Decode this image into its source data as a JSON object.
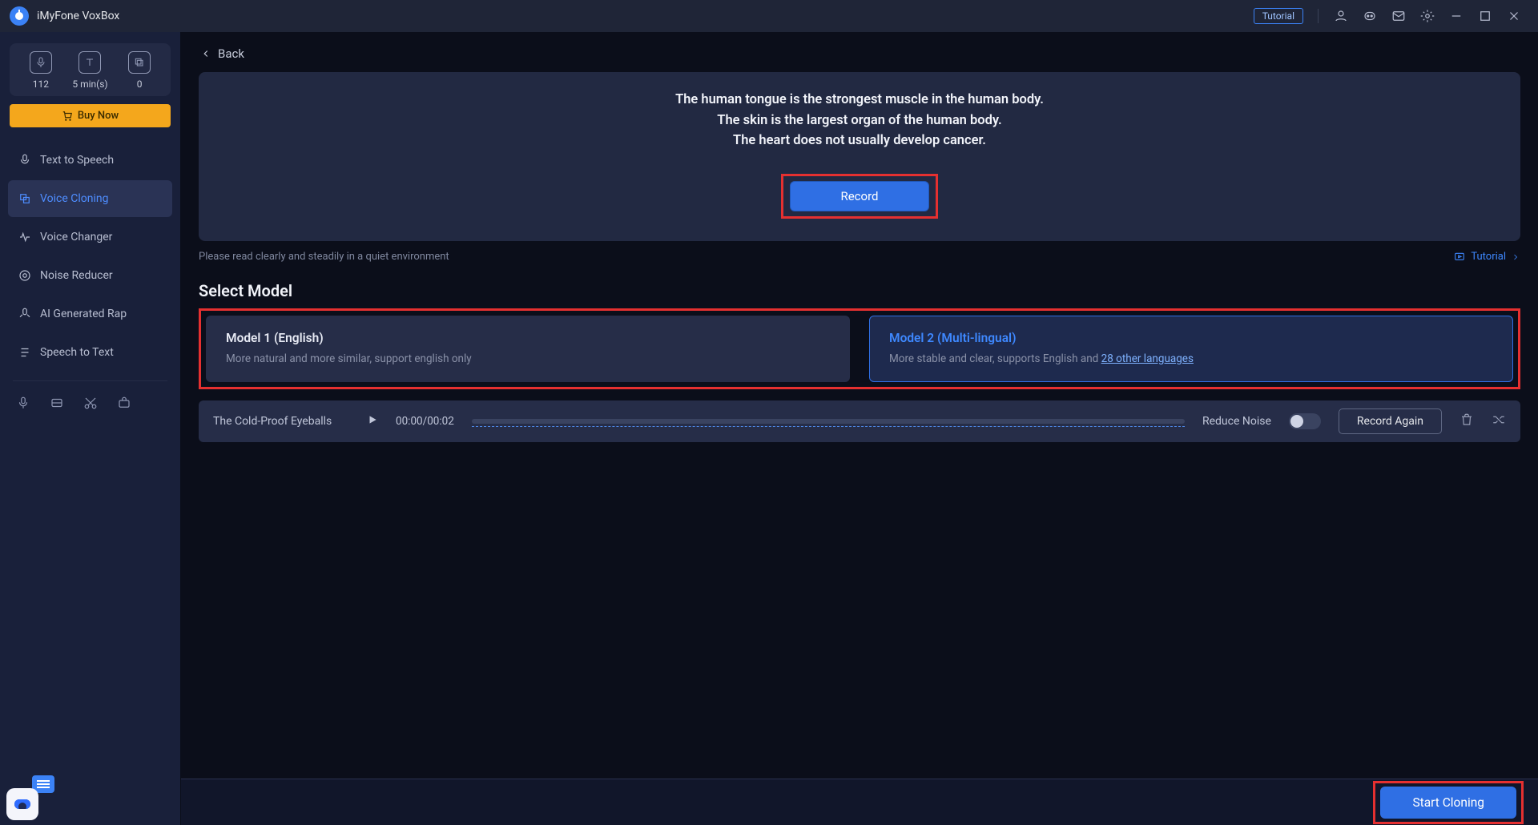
{
  "app": {
    "name": "iMyFone VoxBox",
    "tutorial_label": "Tutorial"
  },
  "sidebar": {
    "stats": [
      {
        "value": "112"
      },
      {
        "value": "5 min(s)"
      },
      {
        "value": "0"
      }
    ],
    "buy_label": "Buy Now",
    "items": [
      {
        "label": "Text to Speech"
      },
      {
        "label": "Voice Cloning"
      },
      {
        "label": "Voice Changer"
      },
      {
        "label": "Noise Reducer"
      },
      {
        "label": "AI Generated Rap"
      },
      {
        "label": "Speech to Text"
      }
    ]
  },
  "main": {
    "back_label": "Back",
    "script_lines": [
      "The human tongue is the strongest muscle in the human body.",
      "The skin is the largest organ of the human body.",
      "The heart does not usually develop cancer."
    ],
    "record_label": "Record",
    "hint": "Please read clearly and steadily in a quiet environment",
    "tutorial_link": "Tutorial",
    "section_title": "Select Model",
    "models": [
      {
        "title": "Model 1 (English)",
        "desc": "More natural and more similar, support english only"
      },
      {
        "title": "Model 2 (Multi-lingual)",
        "desc_prefix": "More stable and clear, supports English and ",
        "desc_link": "28 other languages"
      }
    ],
    "player": {
      "track": "The Cold-Proof Eyeballs",
      "time": "00:00/00:02",
      "reduce_noise": "Reduce Noise",
      "record_again": "Record Again"
    },
    "start_label": "Start Cloning"
  }
}
